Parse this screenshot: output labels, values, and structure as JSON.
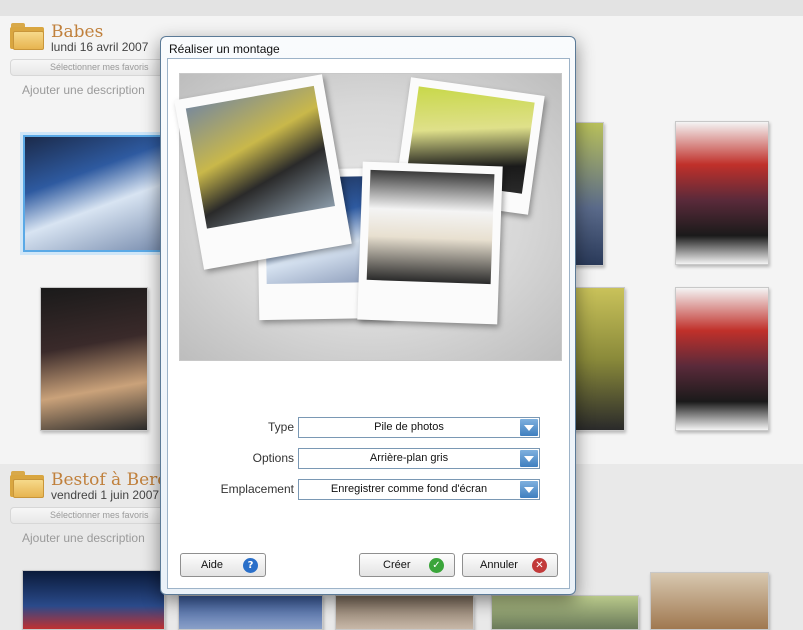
{
  "albums": [
    {
      "title": "Babes",
      "date": "lundi 16 avril 2007",
      "favorites_button": "Sélectionner mes favoris",
      "add_description": "Ajouter une description"
    },
    {
      "title": "Bestof à Bercy",
      "date": "vendredi 1 juin 2007",
      "favorites_button": "Sélectionner mes favoris",
      "add_description": "Ajouter une description"
    }
  ],
  "dialog": {
    "title": "Réaliser un montage",
    "fields": {
      "type": {
        "label": "Type",
        "value": "Pile de photos"
      },
      "options": {
        "label": "Options",
        "value": "Arrière-plan gris"
      },
      "location": {
        "label": "Emplacement",
        "value": "Enregistrer comme fond d'écran"
      }
    },
    "buttons": {
      "help": "Aide",
      "create": "Créer",
      "cancel": "Annuler"
    },
    "icons": {
      "help": "question-icon",
      "create": "checkmark-icon",
      "cancel": "cross-icon"
    }
  },
  "colors": {
    "album_title": "#c0803c",
    "accent_blue": "#3f7fbf",
    "create_green": "#3aa53a",
    "cancel_red": "#c23a3a",
    "help_blue": "#2a6fc9"
  }
}
